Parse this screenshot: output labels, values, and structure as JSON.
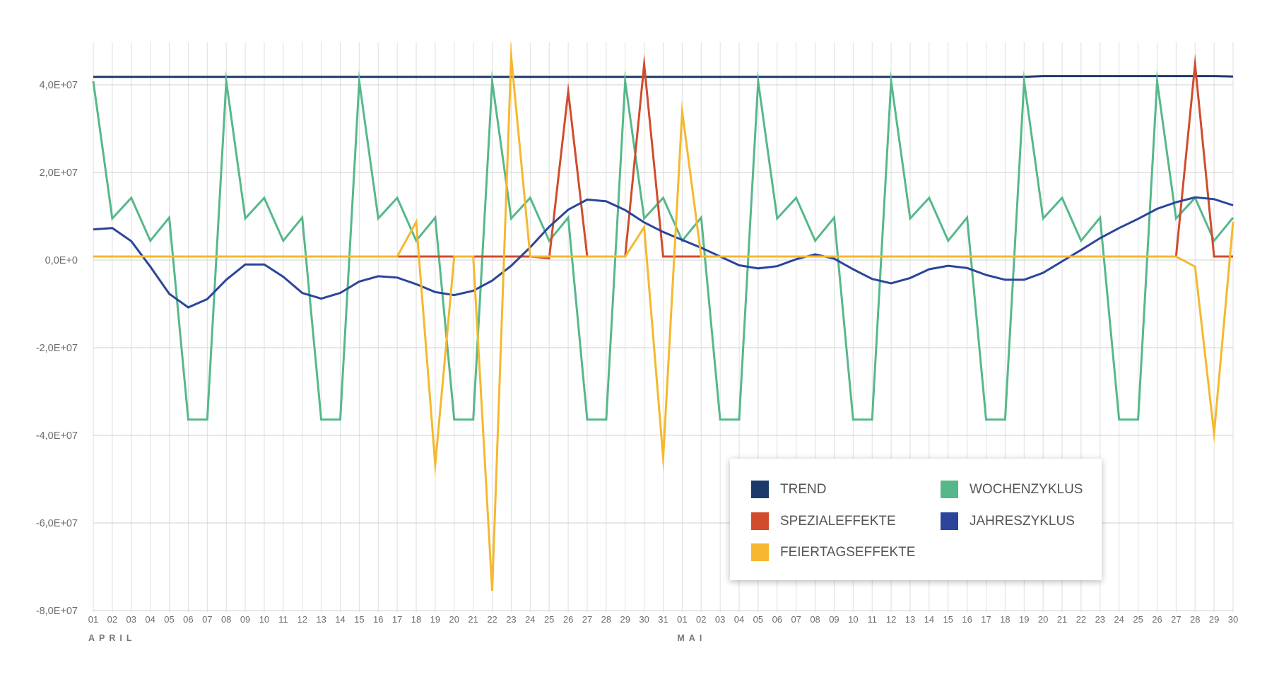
{
  "chart_data": {
    "type": "line",
    "y_ticks": [
      "4,0E+07",
      "2,0E+07",
      "0,0E+0",
      "-2,0E+07",
      "-4,0E+07",
      "-6,0E+07",
      "-8,0E+07"
    ],
    "y_tick_values": [
      40000000,
      20000000,
      0,
      -20000000,
      -40000000,
      -60000000,
      -80000000
    ],
    "ylim": [
      -80000000,
      44000000
    ],
    "grid": true,
    "legend_position": "bottom-right",
    "months": [
      "APRIL",
      "MAI"
    ],
    "x": [
      "01",
      "02",
      "03",
      "04",
      "05",
      "06",
      "07",
      "08",
      "09",
      "10",
      "11",
      "12",
      "13",
      "14",
      "15",
      "16",
      "17",
      "18",
      "19",
      "20",
      "21",
      "22",
      "23",
      "24",
      "25",
      "26",
      "27",
      "28",
      "29",
      "30",
      "31",
      "01",
      "02",
      "03",
      "04",
      "05",
      "06",
      "07",
      "08",
      "09",
      "10",
      "11",
      "12",
      "13",
      "14",
      "15",
      "16",
      "17",
      "18",
      "19",
      "20",
      "21",
      "22",
      "23",
      "24",
      "25",
      "26",
      "27",
      "28",
      "29",
      "30"
    ],
    "series": [
      {
        "name": "TREND",
        "color": "#1b3a6b",
        "values": [
          41800000,
          41800000,
          41800000,
          41800000,
          41800000,
          41800000,
          41800000,
          41800000,
          41800000,
          41800000,
          41800000,
          41800000,
          41800000,
          41800000,
          41800000,
          41800000,
          41800000,
          41800000,
          41800000,
          41800000,
          41800000,
          41800000,
          41800000,
          41800000,
          41800000,
          41800000,
          41800000,
          41800000,
          41800000,
          41800000,
          41800000,
          41800000,
          41800000,
          41800000,
          41800000,
          41800000,
          41800000,
          41800000,
          41800000,
          41800000,
          41800000,
          41800000,
          41800000,
          41800000,
          41800000,
          41800000,
          41800000,
          41800000,
          41800000,
          41800000,
          42000000,
          42000000,
          42000000,
          42000000,
          42000000,
          42000000,
          42000000,
          42000000,
          42000000,
          42000000,
          41900000
        ]
      },
      {
        "name": "WOCHENZYKLUS",
        "color": "#56b88a",
        "values": [
          40800000,
          9500000,
          14200000,
          4400000,
          9700000,
          -36400000,
          -36400000,
          40800000,
          9500000,
          14200000,
          4400000,
          9700000,
          -36400000,
          -36400000,
          40800000,
          9500000,
          14200000,
          4400000,
          9700000,
          -36400000,
          -36400000,
          40800000,
          9500000,
          14200000,
          4400000,
          9700000,
          -36400000,
          -36400000,
          40800000,
          9500000,
          14200000,
          4400000,
          9700000,
          -36400000,
          -36400000,
          40800000,
          9500000,
          14200000,
          4400000,
          9700000,
          -36400000,
          -36400000,
          40800000,
          9500000,
          14200000,
          4400000,
          9700000,
          -36400000,
          -36400000,
          40800000,
          9500000,
          14200000,
          4400000,
          9700000,
          -36400000,
          -36400000,
          40800000,
          9500000,
          14200000,
          4400000,
          9700000
        ]
      },
      {
        "name": "SPEZIALEFFEKTE",
        "color": "#d04c2c",
        "values": [
          800000,
          800000,
          800000,
          800000,
          800000,
          800000,
          800000,
          800000,
          800000,
          800000,
          800000,
          800000,
          800000,
          800000,
          800000,
          800000,
          800000,
          800000,
          800000,
          800000,
          800000,
          800000,
          800000,
          800000,
          400000,
          38500000,
          800000,
          800000,
          800000,
          44700000,
          800000,
          800000,
          800000,
          800000,
          800000,
          800000,
          800000,
          800000,
          800000,
          800000,
          800000,
          800000,
          800000,
          800000,
          800000,
          800000,
          800000,
          800000,
          800000,
          800000,
          800000,
          800000,
          800000,
          800000,
          800000,
          800000,
          800000,
          800000,
          44700000,
          800000,
          800000
        ]
      },
      {
        "name": "JAHRESZYKLUS",
        "color": "#2a4599",
        "values": [
          7000000,
          7300000,
          4300000,
          -1500000,
          -7700000,
          -10800000,
          -8900000,
          -4500000,
          -1000000,
          -1000000,
          -3800000,
          -7500000,
          -8800000,
          -7500000,
          -4900000,
          -3700000,
          -4000000,
          -5500000,
          -7300000,
          -8000000,
          -7000000,
          -4700000,
          -1300000,
          2900000,
          7600000,
          11500000,
          13800000,
          13400000,
          11400000,
          8600000,
          6400000,
          4600000,
          2800000,
          800000,
          -1200000,
          -1900000,
          -1400000,
          200000,
          1300000,
          300000,
          -2100000,
          -4300000,
          -5300000,
          -4100000,
          -2100000,
          -1300000,
          -1800000,
          -3400000,
          -4500000,
          -4500000,
          -2900000,
          -300000,
          2300000,
          5000000,
          7300000,
          9400000,
          11700000,
          13200000,
          14300000,
          13900000,
          12500000
        ]
      },
      {
        "name": "FEIERTAGSEFFEKTE",
        "color": "#f5b82e",
        "values": [
          800000,
          800000,
          800000,
          800000,
          800000,
          800000,
          800000,
          800000,
          800000,
          800000,
          800000,
          800000,
          800000,
          800000,
          800000,
          800000,
          800000,
          8700000,
          -46700000,
          800000,
          800000,
          -75500000,
          46500000,
          800000,
          800000,
          800000,
          800000,
          800000,
          800000,
          7500000,
          -45200000,
          33900000,
          800000,
          800000,
          800000,
          800000,
          800000,
          800000,
          800000,
          800000,
          800000,
          800000,
          800000,
          800000,
          800000,
          800000,
          800000,
          800000,
          800000,
          800000,
          800000,
          800000,
          800000,
          800000,
          800000,
          800000,
          800000,
          800000,
          -1500000,
          -39600000,
          8700000
        ]
      }
    ]
  },
  "legend": {
    "items": [
      {
        "label": "TREND",
        "color": "#1b3a6b"
      },
      {
        "label": "WOCHENZYKLUS",
        "color": "#56b88a"
      },
      {
        "label": "SPEZIALEFFEKTE",
        "color": "#d04c2c"
      },
      {
        "label": "JAHRESZYKLUS",
        "color": "#2a4599"
      },
      {
        "label": "FEIERTAGSEFFEKTE",
        "color": "#f5b82e"
      }
    ]
  }
}
